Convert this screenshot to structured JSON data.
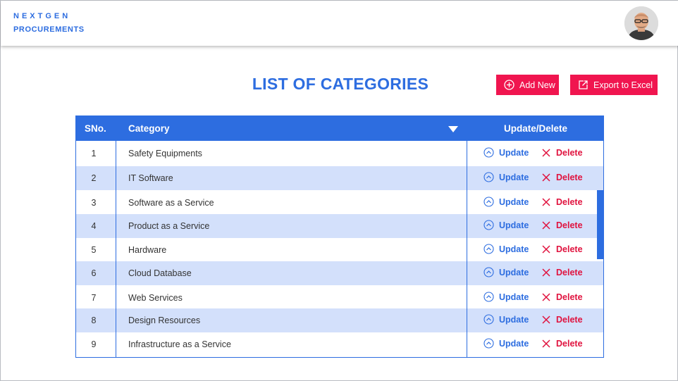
{
  "header": {
    "brand_line1": "NEXTGEN",
    "brand_line2": "PROCUREMENTS"
  },
  "page": {
    "title": "LIST OF CATEGORIES",
    "add_button": "Add New",
    "export_button": "Export to Excel"
  },
  "table": {
    "col_sno": "SNo.",
    "col_category": "Category",
    "col_actions": "Update/Delete",
    "update_label": "Update",
    "delete_label": "Delete",
    "rows": [
      {
        "sno": "1",
        "category": "Safety Equipments"
      },
      {
        "sno": "2",
        "category": "IT Software"
      },
      {
        "sno": "3",
        "category": "Software as a Service"
      },
      {
        "sno": "4",
        "category": "Product as a Service"
      },
      {
        "sno": "5",
        "category": "Hardware"
      },
      {
        "sno": "6",
        "category": "Cloud Database"
      },
      {
        "sno": "7",
        "category": "Web Services"
      },
      {
        "sno": "8",
        "category": "Design Resources"
      },
      {
        "sno": "9",
        "category": "Infrastructure as a Service"
      }
    ]
  },
  "icons": {
    "add": "plus-circle-icon",
    "export": "export-icon",
    "sort": "triangle-down-icon",
    "update": "chevron-up-circle-icon",
    "delete": "x-icon"
  },
  "colors": {
    "accent": "#2d6de0",
    "button": "#f0154f",
    "delete": "#e0123e",
    "row_alt": "#d3e0fb"
  }
}
